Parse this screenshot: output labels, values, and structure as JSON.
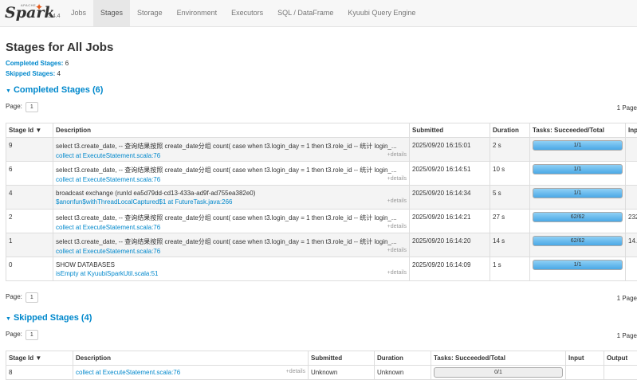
{
  "app": {
    "logo_top": "APACHE",
    "logo": "Spark",
    "version": "3.4.4"
  },
  "nav": [
    {
      "label": "Jobs",
      "active": false
    },
    {
      "label": "Stages",
      "active": true
    },
    {
      "label": "Storage",
      "active": false
    },
    {
      "label": "Environment",
      "active": false
    },
    {
      "label": "Executors",
      "active": false
    },
    {
      "label": "SQL / DataFrame",
      "active": false
    },
    {
      "label": "Kyuubi Query Engine",
      "active": false
    }
  ],
  "page": {
    "title": "Stages for All Jobs",
    "completed_label": "Completed Stages:",
    "completed_count": "6",
    "skipped_label": "Skipped Stages:",
    "skipped_count": "4",
    "completed_section": "Completed Stages (6)",
    "skipped_section": "Skipped Stages (4)",
    "page_label": "Page:",
    "page_num": "1",
    "page_right": "1 Page"
  },
  "completed_table": {
    "headers": [
      "Stage Id ▼",
      "Description",
      "Submitted",
      "Duration",
      "Tasks: Succeeded/Total",
      "Inp"
    ],
    "rows": [
      {
        "id": "9",
        "desc": "select t3.create_date, -- 查询结果按照 create_date分组 count( case when t3.login_day = 1 then t3.role_id -- 统计 login_...",
        "link": "collect at ExecuteStatement.scala:76",
        "more": "+details",
        "submitted": "2025/09/20 16:15:01",
        "duration": "2 s",
        "tasks": "1/1",
        "task_fill": 1.0,
        "input": ""
      },
      {
        "id": "6",
        "desc": "select t3.create_date, -- 查询结果按照 create_date分组 count( case when t3.login_day = 1 then t3.role_id -- 统计 login_...",
        "link": "collect at ExecuteStatement.scala:76",
        "more": "+details",
        "submitted": "2025/09/20 16:14:51",
        "duration": "10 s",
        "tasks": "1/1",
        "task_fill": 1.0,
        "input": ""
      },
      {
        "id": "4",
        "desc": "broadcast exchange (runId ea5d79dd-cd13-433a-ad9f-ad755ea382e0)",
        "link": "$anonfun$withThreadLocalCaptured$1 at FutureTask.java:266",
        "more": "+details",
        "submitted": "2025/09/20 16:14:34",
        "duration": "5 s",
        "tasks": "1/1",
        "task_fill": 1.0,
        "input": ""
      },
      {
        "id": "2",
        "desc": "select t3.create_date, -- 查询结果按照 create_date分组 count( case when t3.login_day = 1 then t3.role_id -- 统计 login_...",
        "link": "collect at ExecuteStatement.scala:76",
        "more": "+details",
        "submitted": "2025/09/20 16:14:21",
        "duration": "27 s",
        "tasks": "62/62",
        "task_fill": 1.0,
        "input": "232"
      },
      {
        "id": "1",
        "desc": "select t3.create_date, -- 查询结果按照 create_date分组 count( case when t3.login_day = 1 then t3.role_id -- 统计 login_...",
        "link": "collect at ExecuteStatement.scala:76",
        "more": "+details",
        "submitted": "2025/09/20 16:14:20",
        "duration": "14 s",
        "tasks": "62/62",
        "task_fill": 1.0,
        "input": "14."
      },
      {
        "id": "0",
        "desc": "SHOW DATABASES",
        "link": "isEmpty at KyuubiSparkUtil.scala:51",
        "more": "+details",
        "submitted": "2025/09/20 16:14:09",
        "duration": "1 s",
        "tasks": "1/1",
        "task_fill": 1.0,
        "input": ""
      }
    ]
  },
  "skipped_table": {
    "headers": [
      "Stage Id ▼",
      "Description",
      "Submitted",
      "Duration",
      "Tasks: Succeeded/Total",
      "Input",
      "Output"
    ],
    "rows": [
      {
        "id": "8",
        "link": "collect at ExecuteStatement.scala:76",
        "more": "+details",
        "submitted": "Unknown",
        "duration": "Unknown",
        "tasks": "0/1",
        "task_fill": 0.0,
        "input": "",
        "output": ""
      }
    ]
  }
}
